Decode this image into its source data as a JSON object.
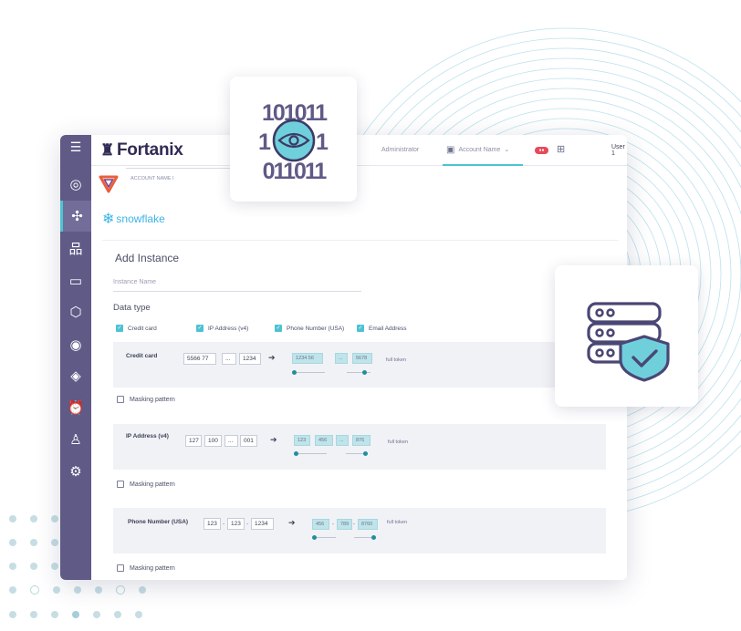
{
  "brand": {
    "name": "Fortanix",
    "accent": "#4cc3d1",
    "sidebar_color": "#5f5a86"
  },
  "topbar": {
    "role_label": "Administrator",
    "account_label": "Account Name",
    "user_label": "User 1"
  },
  "account": {
    "name_label": "ACCOUNT NAME I"
  },
  "connector": {
    "name": "snowflake"
  },
  "sidebar": {
    "icons": [
      "menu-icon",
      "dashboard-icon",
      "plugins-icon",
      "hierarchy-icon",
      "terminal-icon",
      "integration-icon",
      "user-circle-icon",
      "cube-icon",
      "alarm-icon",
      "user-alert-icon",
      "settings-icon"
    ]
  },
  "form": {
    "title": "Add Instance",
    "instance_name_placeholder": "Instance Name",
    "data_type_label": "Data type",
    "checkboxes": [
      {
        "label": "Credit card",
        "checked": true
      },
      {
        "label": "IP Address (v4)",
        "checked": true
      },
      {
        "label": "Phone Number (USA)",
        "checked": true
      },
      {
        "label": "Email Address",
        "checked": true
      }
    ],
    "masking_label": "Masking pattern",
    "full_token_label": "full token",
    "credit": {
      "label": "Credit card",
      "input": [
        "5566 77",
        "...",
        "1234"
      ],
      "tokens": [
        "1234 56",
        "...",
        "5678"
      ]
    },
    "ip": {
      "label": "IP Address (v4)",
      "input": [
        "127",
        "100",
        "...",
        "001"
      ],
      "tokens": [
        "123",
        "456",
        "...",
        "876"
      ]
    },
    "phone": {
      "label": "Phone Number (USA)",
      "input": [
        "123",
        "123",
        "1234"
      ],
      "tokens": [
        "456",
        "789",
        "8760"
      ]
    }
  },
  "binary_card": {
    "row1": "101011",
    "row2_left": "1",
    "row2_right": "1",
    "row3": "011011"
  },
  "icons": {
    "eye": "eye-icon",
    "database_shield": "database-shield-icon"
  }
}
